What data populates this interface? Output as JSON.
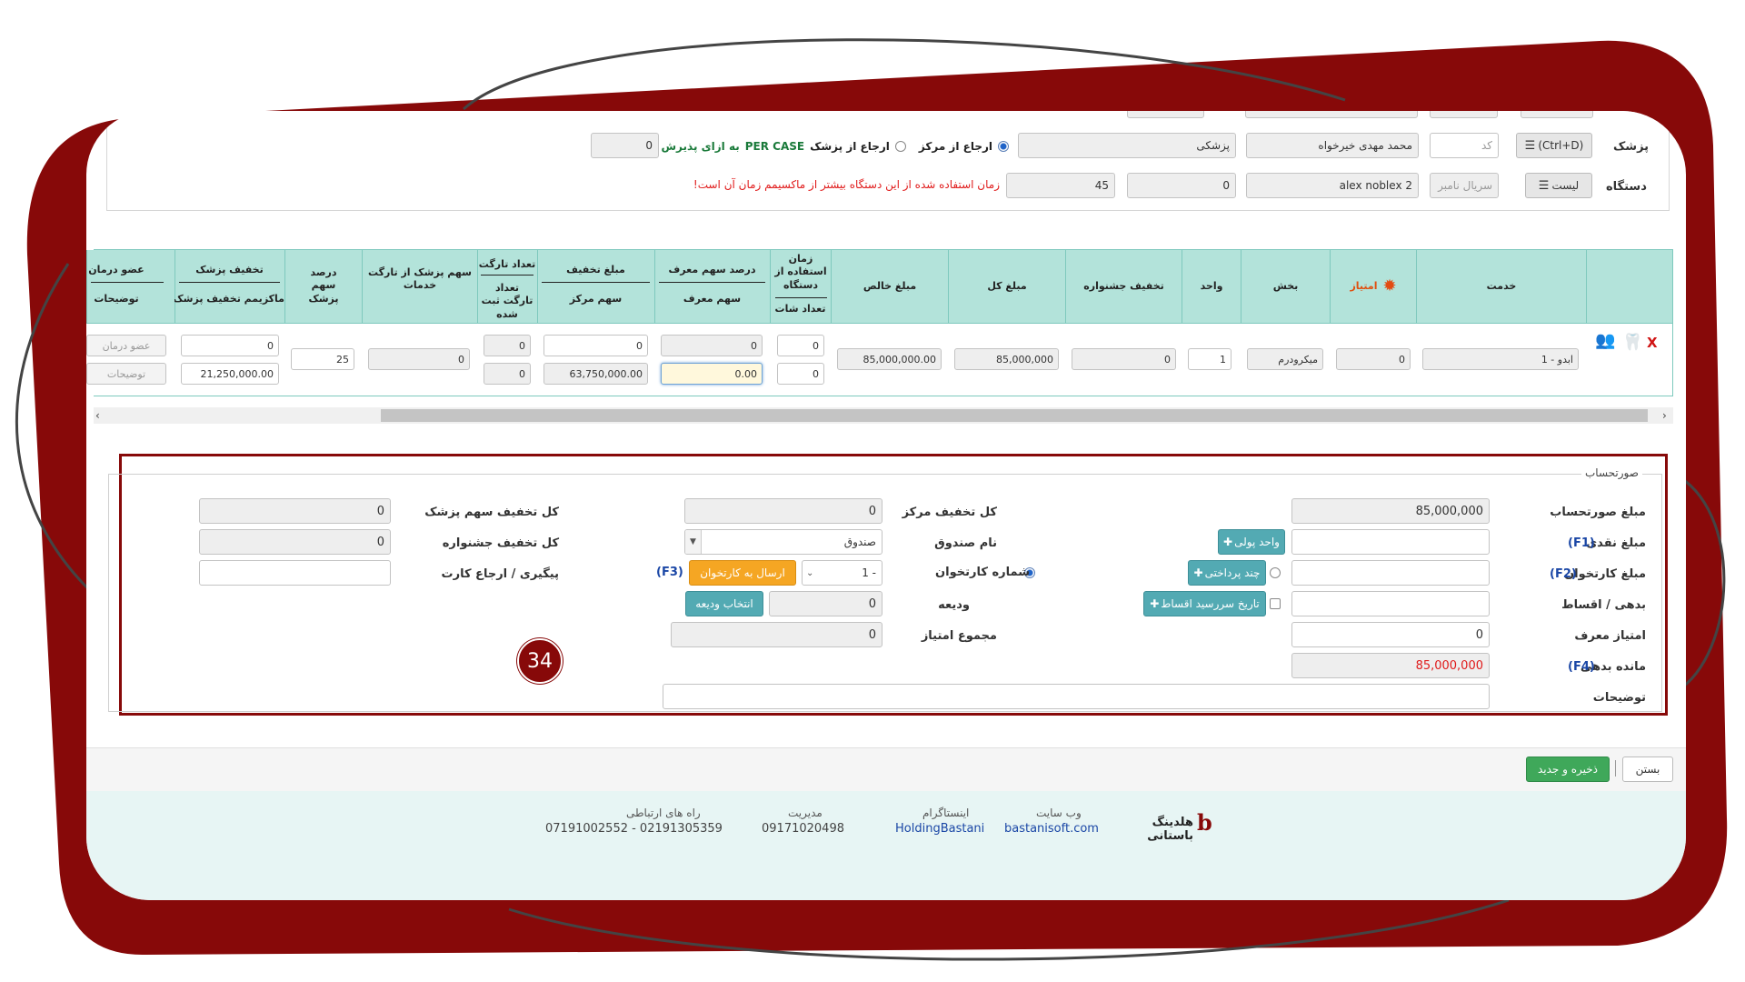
{
  "colors": {
    "frame": "#870909",
    "accent_teal": "#53aab3",
    "header_bg": "#b3e3da",
    "warning": "#e01b1b",
    "link": "#1b47a6",
    "highlight_red": "#e01b1b",
    "step_badge": "#870909"
  },
  "top": {
    "doctor_label": "پزشک",
    "doctor_btn": "(Ctrl+D)",
    "code_placeholder": "کد",
    "doctor_name": "محمد مهدی خیرخواه",
    "specialty": "پزشکی",
    "ref_center": "ارجاع از مرکز",
    "ref_doctor": "ارجاع از پزشک",
    "per_case": "PER CASE",
    "per_admission": "به ازای پذیرش",
    "count_value": "0",
    "device_label": "دستگاه",
    "list_btn": "لیست",
    "serial_placeholder": "سریال نامبر",
    "device_name": "alex noblex 2",
    "device_val1": "0",
    "device_val2": "45",
    "warning_text": "زمان استفاده شده از این دستگاه بیشتر از ماکسیمم زمان آن است!"
  },
  "table": {
    "headers": {
      "service": "خدمت",
      "points": "امتیاز",
      "section": "بخش",
      "unit": "واحد",
      "festival_discount": "تخفیف جشنواره",
      "total_amount": "مبلغ کل",
      "net_amount": "مبلغ خالص",
      "device_time": "زمان استفاده از دستگاه",
      "shots_count": "تعداد شات",
      "referrer_pct": "درصد سهم معرف",
      "referrer_share": "سهم معرف",
      "discount_amount": "مبلغ تخفیف",
      "center_share": "سهم مرکز",
      "target_count": "تعداد تارگت",
      "target_registered": "تعداد تارگت ثبت شده",
      "doctor_target_share": "سهم پزشک از تارگت خدمات",
      "doctor_pct": "درصد سهم پزشک",
      "doctor_discount": "تخفیف پزشک",
      "max_doctor_discount": "ماکزیمم تخفیف پزشک",
      "treatment_member": "عضو درمان",
      "notes": "توضیحات"
    },
    "row": {
      "delete": "X",
      "service": "1 - ابدو",
      "points": "0",
      "section": "میکرودرم",
      "unit": "1",
      "festival_discount": "0",
      "total_amount": "85,000,000",
      "net_amount": "85,000,000.00",
      "device_time": "0",
      "shots_count": "0",
      "referrer_pct": "0",
      "referrer_share": "0.00",
      "discount_amount": "0",
      "center_share": "63,750,000.00",
      "target_count": "0",
      "target_registered": "0",
      "doctor_target_share": "0",
      "doctor_pct": "25",
      "doctor_discount": "0",
      "max_doctor_discount": "21,250,000.00",
      "treatment_member_placeholder": "عضو درمان",
      "notes_placeholder": "توضیحات"
    }
  },
  "invoice": {
    "legend": "صورتحساب",
    "invoice_amount_label": "مبلغ صورتحساب",
    "invoice_amount": "85,000,000",
    "cash_label": "مبلغ نقدی",
    "cash_key": "(F1)",
    "currency_btn": "واحد پولی",
    "card_label": "مبلغ کارتخوان",
    "card_key": "(F2)",
    "multi_pay_btn": "چند پرداختی",
    "debt_label": "بدهی / اقساط",
    "installment_btn": "تاریخ سررسید اقساط",
    "referrer_points_label": "امتیاز معرف",
    "referrer_points": "0",
    "remaining_label": "مانده بدهی",
    "remaining_key": "(F4)",
    "remaining": "85,000,000",
    "notes_label": "توضیحات",
    "center_discount_label": "کل تخفیف مرکز",
    "center_discount": "0",
    "cashbox_label": "نام صندوق",
    "cashbox_value": "صندوق",
    "pos_label": "شماره کارتخوان",
    "pos_value": "1 -",
    "send_pos_btn": "ارسال به کارتخوان",
    "send_pos_key": "(F3)",
    "deposit_label": "ودیعه",
    "deposit_value": "0",
    "select_deposit_btn": "انتخاب ودیعه",
    "total_points_label": "مجموع امتیاز",
    "total_points": "0",
    "doctor_share_discount_label": "کل تخفیف سهم پزشک",
    "doctor_share_discount": "0",
    "festival_total_label": "کل تخفیف جشنواره",
    "festival_total": "0",
    "card_track_label": "پیگیری / ارجاع کارت",
    "step_badge": "34"
  },
  "actions": {
    "close": "بستن",
    "save_new": "ذخیره و جدید"
  },
  "footer": {
    "company": "هلدینگ باستانی",
    "website_label": "وب سایت",
    "website": "bastanisoft.com",
    "instagram_label": "اینستاگرام",
    "instagram": "HoldingBastani",
    "management_label": "مدیریت",
    "management": "09171020498",
    "contact_label": "راه های ارتباطی",
    "contact": "07191002552 - 02191305359"
  }
}
